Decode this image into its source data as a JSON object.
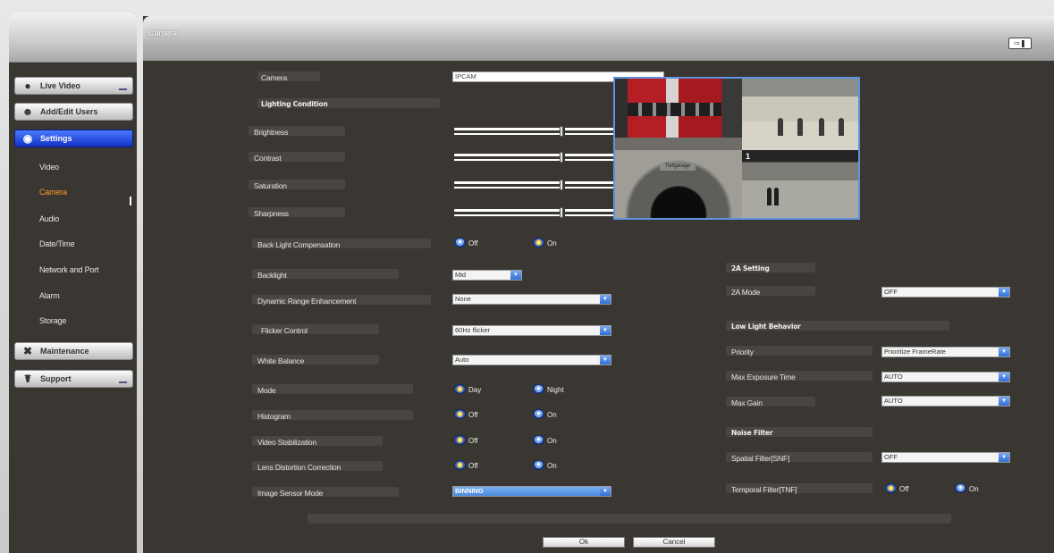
{
  "main": {
    "title": "Camera"
  },
  "sidebar": {
    "items": [
      {
        "label": "Live Video",
        "icon": "video-camera-icon"
      },
      {
        "label": "Add/Edit Users",
        "icon": "users-icon"
      },
      {
        "label": "Settings",
        "icon": "settings-globe-icon",
        "active": true
      },
      {
        "label": "Maintenance",
        "icon": "tools-icon"
      },
      {
        "label": "Support",
        "icon": "support-icon"
      }
    ],
    "settings_sub": [
      "Video",
      "Camera",
      "Audio",
      "Date/Time",
      "Network and Port",
      "Alarm",
      "Storage"
    ],
    "active_sub": "Camera"
  },
  "form": {
    "camera_label": "Camera",
    "camera_value": "IPCAM",
    "lighting_heading": "Lighting Condition",
    "brightness": {
      "label": "Brightness",
      "value": "128",
      "level": 0.5
    },
    "contrast": {
      "label": "Contrast",
      "value": "128",
      "level": 0.5
    },
    "saturation": {
      "label": "Saturation",
      "value": "128",
      "level": 0.5
    },
    "sharpness": {
      "label": "Sharpness",
      "value": "128",
      "level": 0.5
    },
    "blc": {
      "label": "Back Light Compensation",
      "opt1": "Off",
      "opt2": "On",
      "selected": "On"
    },
    "backlight": {
      "label": "Backlight",
      "value": "Mid"
    },
    "dre": {
      "label": "Dynamic Range Enhancement",
      "value": "None"
    },
    "flicker": {
      "label": "Flicker Control",
      "value": "60Hz flicker"
    },
    "wb": {
      "label": "White Balance",
      "value": "Auto"
    },
    "mode": {
      "label": "Mode",
      "opt1": "Day",
      "opt2": "Night",
      "selected": "Day"
    },
    "histogram": {
      "label": "Histogram",
      "opt1": "Off",
      "opt2": "On",
      "selected": "Off"
    },
    "vstab": {
      "label": "Video Stabilization",
      "opt1": "Off",
      "opt2": "On",
      "selected": "Off"
    },
    "ldc": {
      "label": "Lens Distortion Correction",
      "opt1": "Off",
      "opt2": "On",
      "selected": "Off"
    },
    "ism": {
      "label": "Image Sensor Mode",
      "value": "BINNING"
    }
  },
  "right": {
    "twoa_heading": "2A Setting",
    "twoa_mode": {
      "label": "2A Mode",
      "value": "OFF"
    },
    "lowlight_heading": "Low Light Behavior",
    "priority": {
      "label": "Priority",
      "value": "Prioritize FrameRate"
    },
    "max_exposure": {
      "label": "Max Exposure Time",
      "value": "AUTO"
    },
    "max_gain": {
      "label": "Max Gain",
      "value": "AUTO"
    },
    "noise_heading": "Noise Filter",
    "spatial": {
      "label": "Spatial Filter[SNF]",
      "value": "OFF"
    },
    "temporal": {
      "label": "Temporal Filter[TNF]",
      "opt1": "Off",
      "opt2": "On",
      "selected": "Off"
    }
  },
  "preview": {
    "tile3_sign": "Tiefgarage",
    "tile4_number": "1"
  },
  "buttons": {
    "ok": "Ok",
    "cancel": "Cancel"
  },
  "colors": {
    "panel": "#3a3632",
    "accent_active": "#1232c6",
    "active_sub": "#ff9a2a"
  }
}
